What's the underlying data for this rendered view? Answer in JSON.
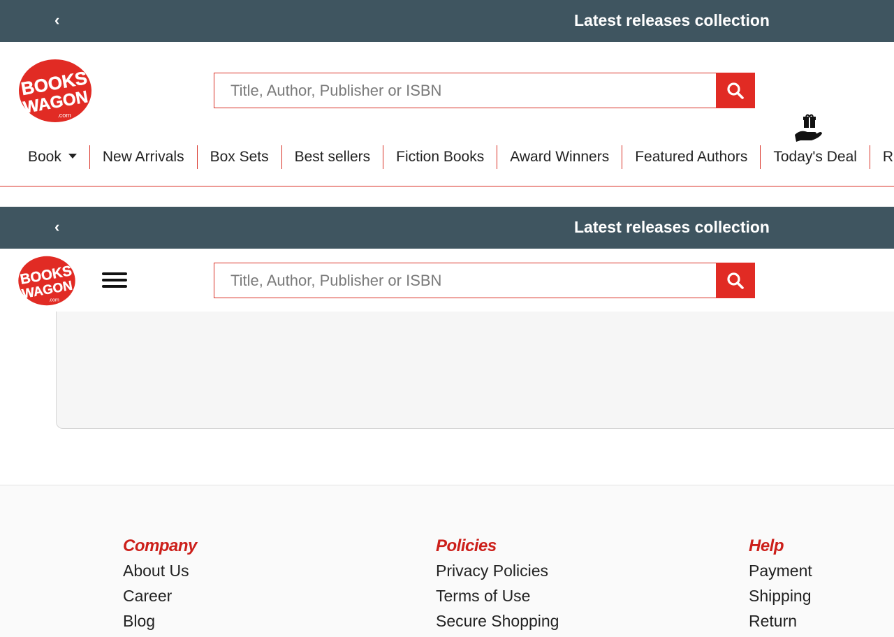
{
  "promo": {
    "prev_label": "‹",
    "text": "Latest releases collection"
  },
  "brand": {
    "logo_line1": "BOOKS",
    "logo_line2": "WAGON",
    "logo_suffix": ".com",
    "red": "#e12b24"
  },
  "search": {
    "placeholder": "Title, Author, Publisher or ISBN"
  },
  "nav": {
    "book": "Book",
    "new_arrivals": "New Arrivals",
    "box_sets": "Box Sets",
    "best_sellers": "Best sellers",
    "fiction_books": "Fiction Books",
    "award_winners": "Award Winners",
    "featured_authors": "Featured Authors",
    "todays_deal": "Today's Deal",
    "truncated": "Re"
  },
  "footer": {
    "company": {
      "title": "Company",
      "links": [
        "About Us",
        "Career",
        "Blog"
      ]
    },
    "policies": {
      "title": "Policies",
      "links": [
        "Privacy Policies",
        "Terms of Use",
        "Secure Shopping"
      ]
    },
    "help": {
      "title": "Help",
      "links": [
        "Payment",
        "Shipping",
        "Return"
      ]
    }
  },
  "colors": {
    "promo_bar": "#3f5560",
    "accent_red": "#e12b24",
    "footer_heading": "#cc1f1a"
  }
}
